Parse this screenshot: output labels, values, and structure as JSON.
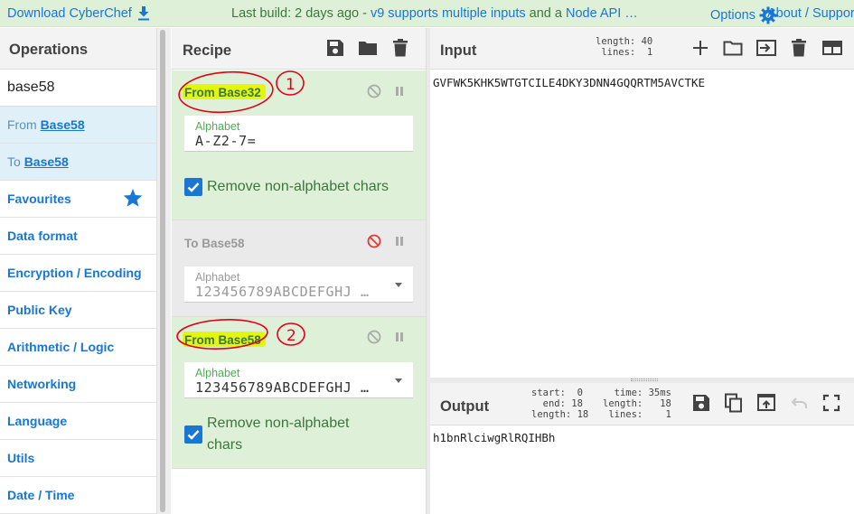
{
  "banner": {
    "download_label": "Download CyberChef",
    "message_prefix": "Last build: 2 days ago - ",
    "message_link1": "v9 supports multiple inputs",
    "message_middle": " and a ",
    "message_link2": "Node API …",
    "options_label": "Options",
    "about_label": "About / Suppor"
  },
  "operations": {
    "title": "Operations",
    "search_value": "base58",
    "results": [
      {
        "prefix": "From ",
        "term": "Base58"
      },
      {
        "prefix": "To ",
        "term": "Base58"
      }
    ],
    "categories": [
      "Favourites",
      "Data format",
      "Encryption / Encoding",
      "Public Key",
      "Arithmetic / Logic",
      "Networking",
      "Language",
      "Utils",
      "Date / Time"
    ]
  },
  "recipe": {
    "title": "Recipe",
    "steps": [
      {
        "name": "From Base32",
        "enabled": true,
        "annotation": "1",
        "field_label": "Alphabet",
        "field_value": "A-Z2-7=",
        "checkbox_label": "Remove non-alphabet chars"
      },
      {
        "name": "To Base58",
        "enabled": false,
        "field_label": "Alphabet",
        "field_value": "123456789ABCDEFGHJ …"
      },
      {
        "name": "From Base58",
        "enabled": true,
        "annotation": "2",
        "field_label": "Alphabet",
        "field_value": "123456789ABCDEFGHJ …",
        "checkbox_label_line1": "Remove non-alphabet",
        "checkbox_label_line2": "chars"
      }
    ]
  },
  "input": {
    "title": "Input",
    "stats": "length: 40\n lines:  1",
    "text": "GVFWK5KHK5WTGTCILE4DKY3DNN4GQQRTM5AVCTKE"
  },
  "output": {
    "title": "Output",
    "stats_left": "start:  0\n  end: 18\nlength: 18",
    "stats_right": "  time: 35ms\nlength:   18\n lines:    1",
    "text": "h1bnRlciwgRlRQIHBh"
  },
  "colors": {
    "accent": "#1976d2",
    "success_bg": "#dff0d8",
    "success_text": "#3c763d",
    "highlight": "#e2f70b",
    "annotation": "#e0001b",
    "disabled_icon": "#e53935"
  }
}
